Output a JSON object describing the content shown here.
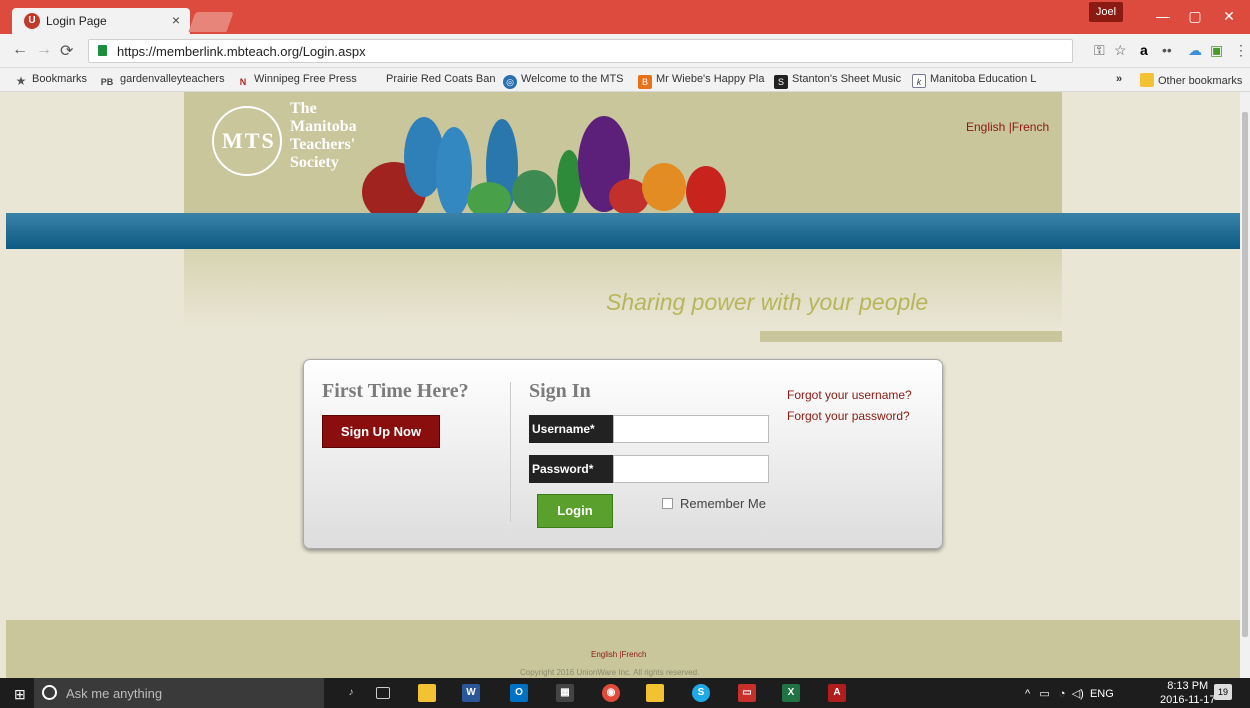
{
  "browser": {
    "tab_title": "Login Page",
    "tab_close": "×",
    "user": "Joel",
    "url": "https://memberlink.mbteach.org/Login.aspx",
    "minimize": "—",
    "maximize": "▢",
    "close": "✕",
    "bookmarks": [
      "Bookmarks",
      "gardenvalleyteachers",
      "Winnipeg Free Press",
      "Prairie Red Coats Ban",
      "Welcome to the MTS",
      "Mr Wiebe's Happy Pla",
      "Stanton's Sheet Music",
      "Manitoba Education L",
      "»",
      "Other bookmarks"
    ]
  },
  "site": {
    "logo_letters": "MTS",
    "logo_lines": [
      "The",
      "Manitoba",
      "Teachers'",
      "Society"
    ],
    "lang_top": "English |French",
    "tagline": "Sharing power with your people"
  },
  "login": {
    "first_time_heading": "First Time Here?",
    "signup_label": "Sign Up Now",
    "signin_heading": "Sign In",
    "username_label": "Username*",
    "username_value": "",
    "password_label": "Password*",
    "password_value": "",
    "login_label": "Login",
    "remember_label": "Remember Me",
    "forgot_username": "Forgot your username?",
    "forgot_password": "Forgot your password?"
  },
  "footer": {
    "lang": "English |French",
    "copyright": "Copyright 2016 UnionWare Inc. All rights reserved."
  },
  "taskbar": {
    "search_placeholder": "Ask me anything",
    "language": "ENG",
    "time": "8:13 PM",
    "date": "2016-11-17",
    "notifications": "19"
  },
  "colors": {
    "chrome_red": "#dd4b3e",
    "header_olive": "#c9c69c",
    "band_blue": "#0d5a82",
    "signup_red": "#8b0e0e",
    "login_green": "#5aa02c",
    "link_red": "#8b1a12"
  }
}
